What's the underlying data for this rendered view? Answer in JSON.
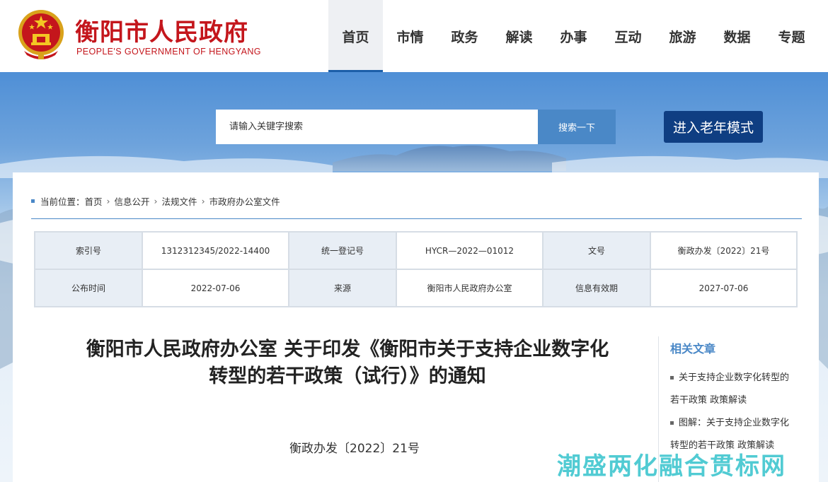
{
  "header": {
    "site_title": "衡阳市人民政府",
    "site_subtitle": "PEOPLE'S GOVERNMENT OF HENGYANG",
    "emblem_icon": "national-emblem-icon",
    "brand_color": "#c4161c",
    "nav": [
      {
        "label": "首页",
        "active": true
      },
      {
        "label": "市情"
      },
      {
        "label": "政务"
      },
      {
        "label": "解读"
      },
      {
        "label": "办事"
      },
      {
        "label": "互动"
      },
      {
        "label": "旅游"
      },
      {
        "label": "数据"
      },
      {
        "label": "专题"
      }
    ]
  },
  "search": {
    "placeholder": "请输入关键字搜索",
    "button_label": "搜索一下",
    "button_color": "#4a88c7"
  },
  "elder_mode": {
    "label": "进入老年模式",
    "color": "#0f3e82"
  },
  "breadcrumb": {
    "prefix": "当前位置：",
    "items": [
      "首页",
      "信息公开",
      "法规文件",
      "市政府办公室文件"
    ]
  },
  "meta": {
    "rows": [
      [
        {
          "key": "索引号",
          "value": "1312312345/2022-14400"
        },
        {
          "key": "统一登记号",
          "value": "HYCR—2022—01012"
        },
        {
          "key": "文号",
          "value": "衡政办发〔2022〕21号"
        }
      ],
      [
        {
          "key": "公布时间",
          "value": "2022-07-06"
        },
        {
          "key": "来源",
          "value": "衡阳市人民政府办公室"
        },
        {
          "key": "信息有效期",
          "value": "2027-07-06"
        }
      ]
    ]
  },
  "article": {
    "title_line1": "衡阳市人民政府办公室 关于印发《衡阳市关于支持企业数字化",
    "title_line2": "转型的若干政策（试行）》的通知",
    "doc_number": "衡政办发〔2022〕21号"
  },
  "related": {
    "title": "相关文章",
    "items": [
      {
        "line1": "关于支持企业数字化转型的",
        "line2": "若干政策 政策解读"
      },
      {
        "line1": "图解：关于支持企业数字化",
        "line2": "转型的若干政策 政策解读"
      }
    ]
  },
  "watermark": "潮盛两化融合贯标网"
}
